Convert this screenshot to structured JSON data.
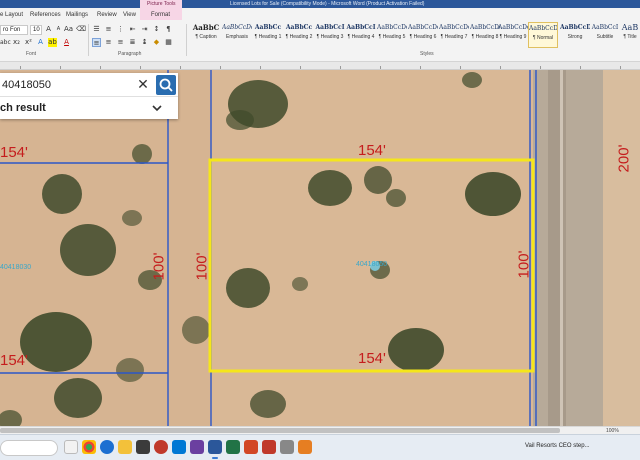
{
  "window": {
    "title": "Licensed Lots for Sale (Compatibility Mode) - Microsoft Word (Product Activation Failed)"
  },
  "ribbon": {
    "context_group": "Picture Tools",
    "tabs": [
      "e Layout",
      "References",
      "Mailings",
      "Review",
      "View",
      "Format"
    ],
    "font": {
      "name": "ro Fon",
      "size": "10"
    },
    "group_labels": {
      "font": "Font",
      "paragraph": "Paragraph",
      "styles": "Styles"
    },
    "styles": [
      {
        "sample": "AaBbC",
        "name": "¶ Caption"
      },
      {
        "sample": "AaBbCcDc",
        "name": "Emphasis"
      },
      {
        "sample": "AaBbCc",
        "name": "¶ Heading 1"
      },
      {
        "sample": "AaBbCc",
        "name": "¶ Heading 2"
      },
      {
        "sample": "AaBbCcI",
        "name": "¶ Heading 3"
      },
      {
        "sample": "AaBbCcI",
        "name": "¶ Heading 4"
      },
      {
        "sample": "AaBbCcDc",
        "name": "¶ Heading 5"
      },
      {
        "sample": "AaBbCcDc",
        "name": "¶ Heading 6"
      },
      {
        "sample": "AaBbCcDc",
        "name": "¶ Heading 7"
      },
      {
        "sample": "AaBbCcDc",
        "name": "¶ Heading 8"
      },
      {
        "sample": "AaBbCcDc",
        "name": "¶ Heading 9"
      },
      {
        "sample": "AaBbCcDc",
        "name": "¶ Normal"
      },
      {
        "sample": "AaBbCcDd",
        "name": "Strong"
      },
      {
        "sample": "AaBbCcI",
        "name": "Subtitle"
      },
      {
        "sample": "AaB",
        "name": "¶ Title"
      }
    ],
    "selected_style_index": 11
  },
  "search": {
    "value": "40418050",
    "results_label": "ch result"
  },
  "map": {
    "dimensions": {
      "top": "154'",
      "bottom": "154'",
      "left": "100'",
      "right": "100'",
      "neighbor_top": "154'",
      "neighbor_bottom": "154'",
      "neighbor_side": "100'",
      "far_right": "200'"
    },
    "parcel_ids": {
      "main": "40418050",
      "neighbor": "40418030"
    },
    "colors": {
      "highlight": "#f5e61a",
      "parcel_lines": "#2b56c8",
      "dimension_text": "#c51d1d",
      "parcel_id_text": "#3aa7c9",
      "ground": "#d9b896"
    }
  },
  "status": {
    "zoom": "100%"
  },
  "taskbar": {
    "news": "Vail Resorts CEO step..."
  }
}
